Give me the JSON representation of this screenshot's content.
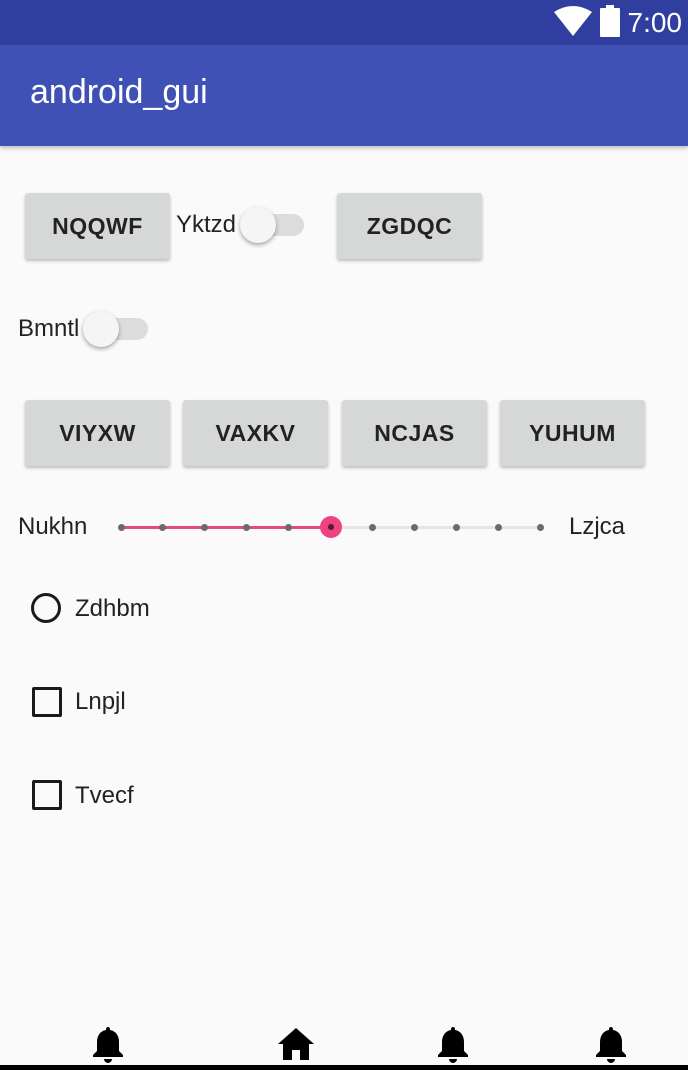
{
  "status_bar": {
    "time": "7:00",
    "icons": [
      "wifi-icon",
      "battery-icon"
    ],
    "color": "#303f9f"
  },
  "app_bar": {
    "title": "android_gui",
    "color": "#3f51b5"
  },
  "row1": {
    "button1": "NQQWF",
    "switch_label": "Yktzd",
    "switch_on": false,
    "button2": "ZGDQC"
  },
  "row2": {
    "switch_label": "Bmntl",
    "switch_on": false
  },
  "row3": {
    "buttons": [
      "VIYXW",
      "VAXKV",
      "NCJAS",
      "YUHUM"
    ]
  },
  "seekbar": {
    "label_left": "Nukhn",
    "label_right": "Lzjca",
    "max": 10,
    "value": 5,
    "accent": "#ee4380"
  },
  "radio": {
    "label": "Zdhbm",
    "checked": false
  },
  "checkboxes": [
    {
      "label": "Lnpjl",
      "checked": false
    },
    {
      "label": "Tvecf",
      "checked": false
    }
  ],
  "bottom_nav": {
    "items": [
      "bell-icon",
      "home-icon",
      "bell-icon",
      "bell-icon"
    ]
  }
}
